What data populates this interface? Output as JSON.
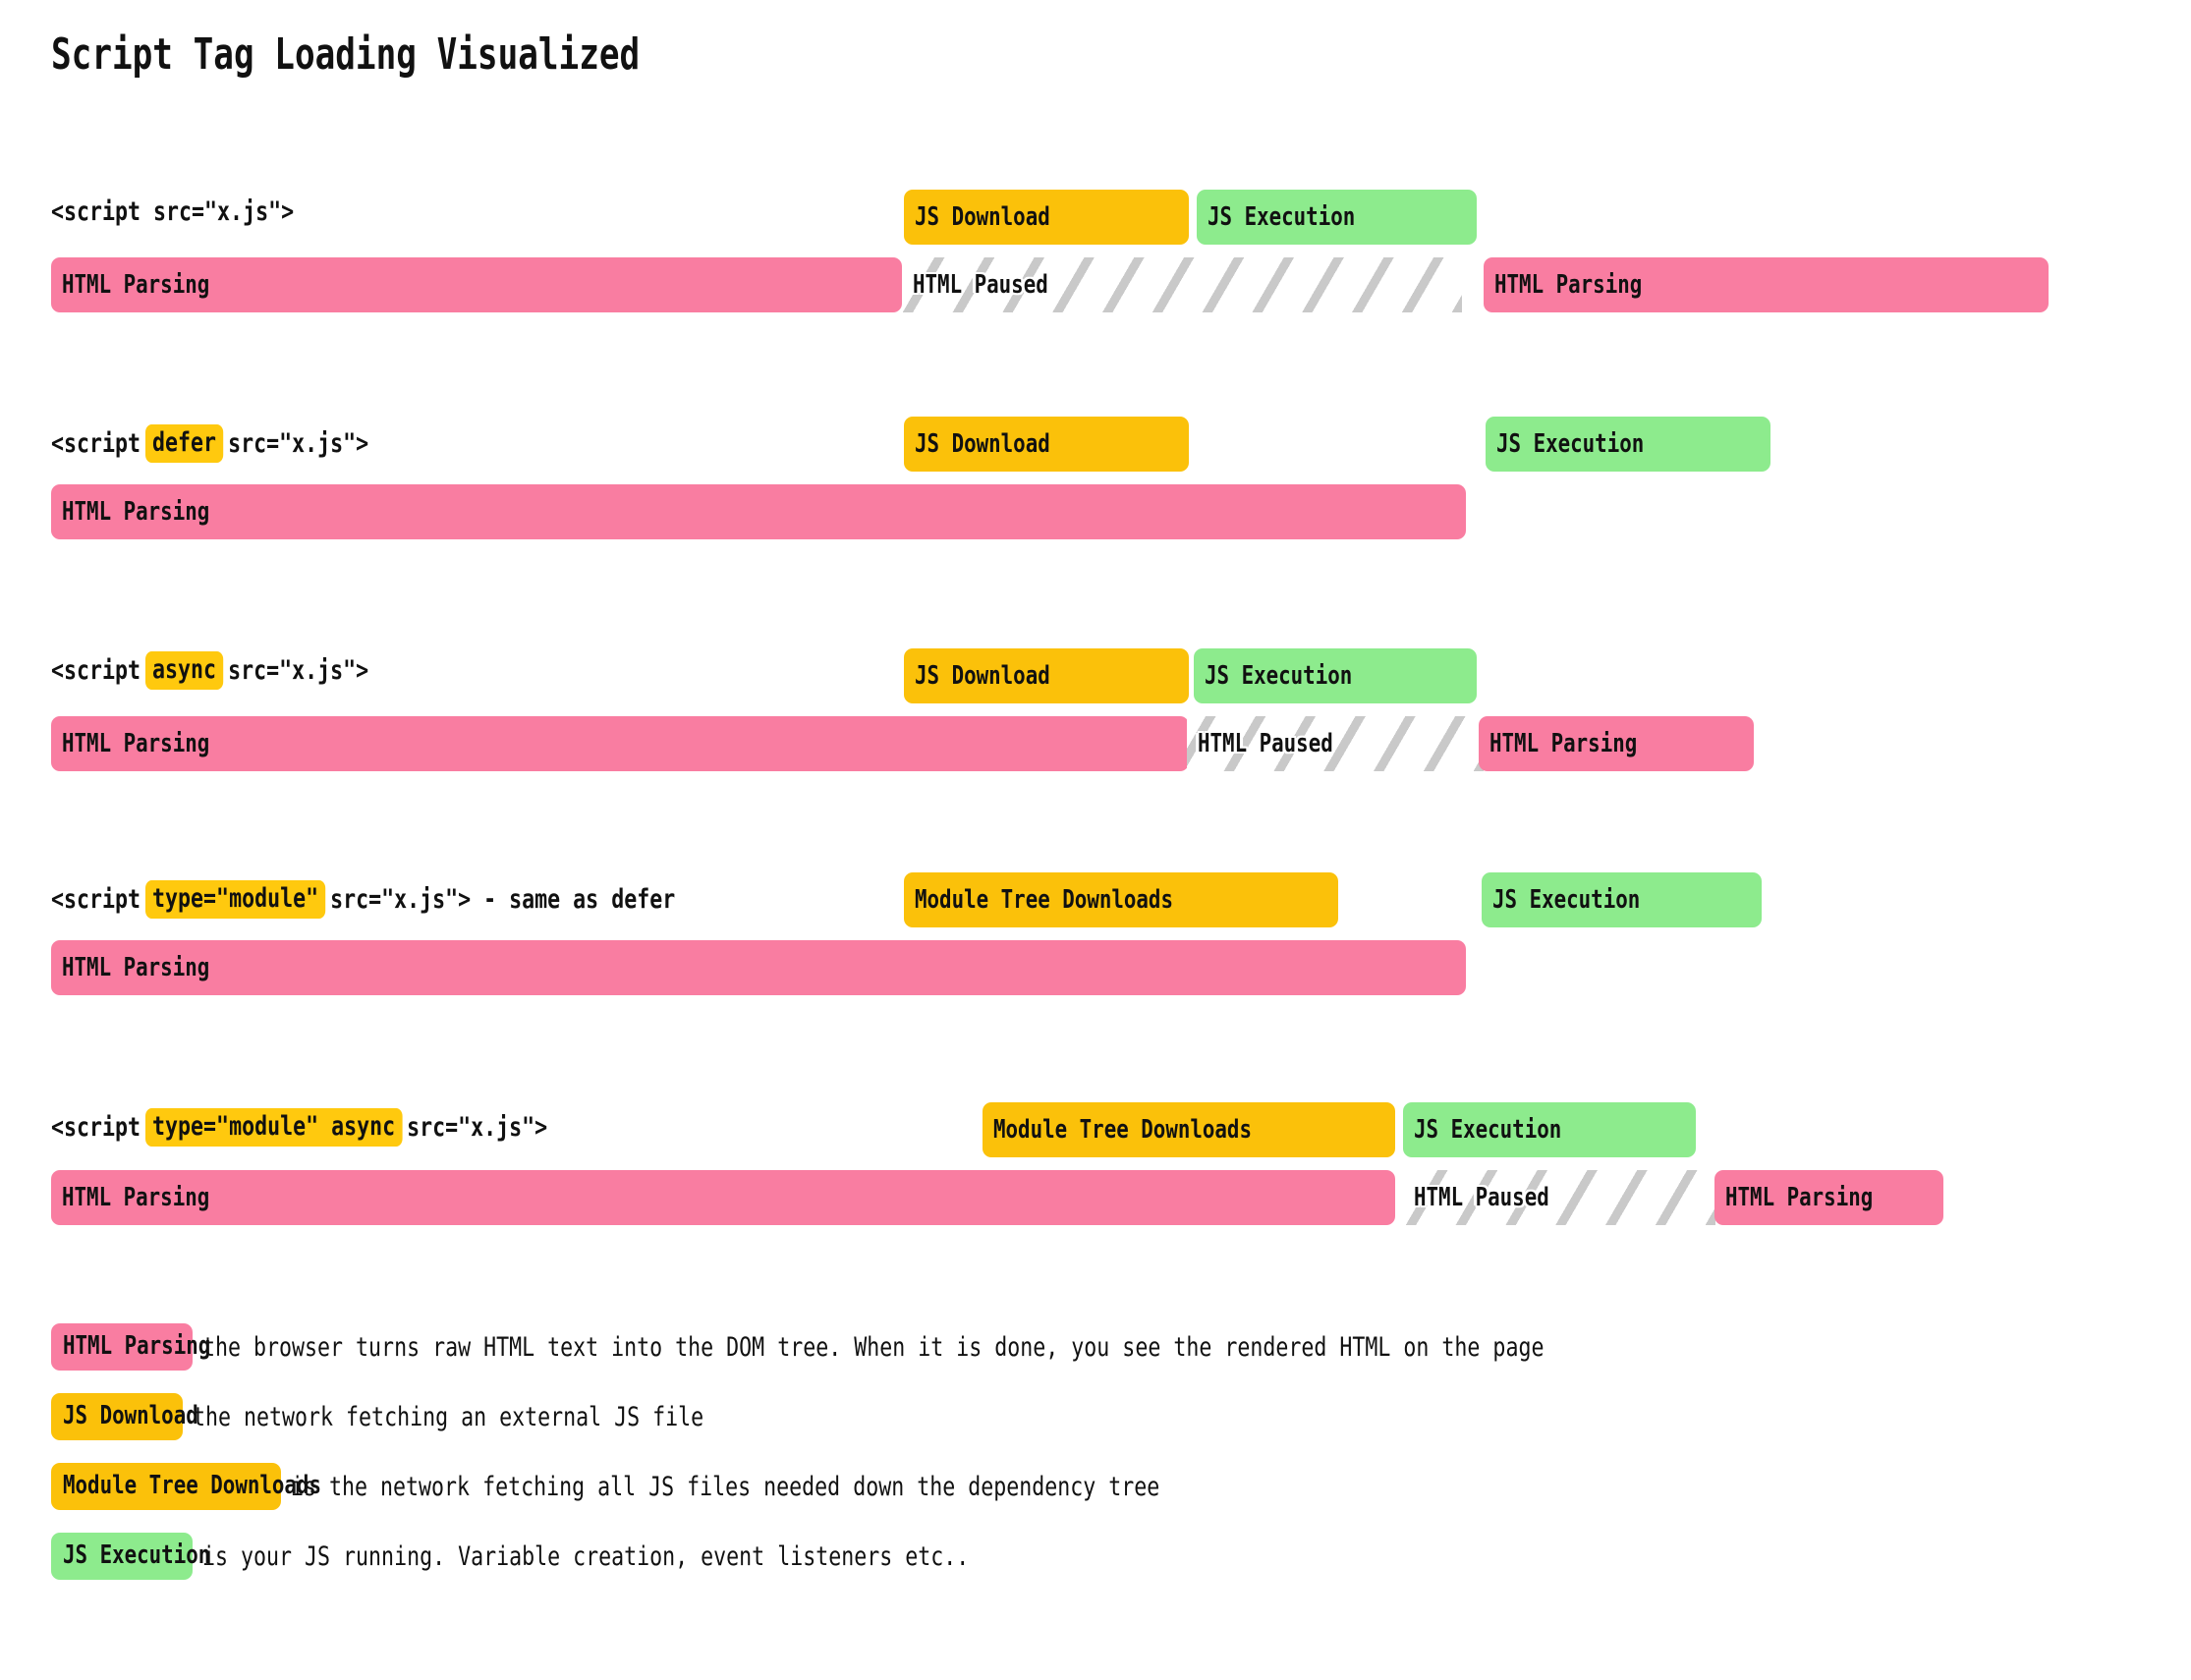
{
  "title": "Script Tag Loading Visualized",
  "colors": {
    "html_parsing": "#F97DA1",
    "js_download": "#FBC10A",
    "module_tree": "#FBC10A",
    "js_execution": "#8DEB8D",
    "html_paused_stripe": "#C9C9C9",
    "background": "#FFFFFF",
    "highlight": "#FFC90E"
  },
  "rows": [
    {
      "id": "plain-script",
      "label_parts": [
        {
          "text": "<script src=\"x.js\">",
          "highlight": false
        }
      ],
      "top_bars": [
        {
          "name": "js-download",
          "label": "JS Download",
          "kind": "yellow"
        },
        {
          "name": "js-execution",
          "label": "JS Execution",
          "kind": "green"
        }
      ],
      "bottom_bars": [
        {
          "name": "html-parsing",
          "label": "HTML Parsing",
          "kind": "pink"
        },
        {
          "name": "html-paused",
          "label": "HTML Paused",
          "kind": "paused"
        },
        {
          "name": "html-parsing",
          "label": "HTML Parsing",
          "kind": "pink"
        }
      ]
    },
    {
      "id": "defer-script",
      "label_parts": [
        {
          "text": "<script",
          "highlight": false
        },
        {
          "text": "defer",
          "highlight": true
        },
        {
          "text": "src=\"x.js\">",
          "highlight": false
        }
      ],
      "top_bars": [
        {
          "name": "js-download",
          "label": "JS Download",
          "kind": "yellow"
        },
        {
          "name": "js-execution",
          "label": "JS Execution",
          "kind": "green"
        }
      ],
      "bottom_bars": [
        {
          "name": "html-parsing",
          "label": "HTML Parsing",
          "kind": "pink"
        }
      ]
    },
    {
      "id": "async-script",
      "label_parts": [
        {
          "text": "<script",
          "highlight": false
        },
        {
          "text": "async",
          "highlight": true
        },
        {
          "text": "src=\"x.js\">",
          "highlight": false
        }
      ],
      "top_bars": [
        {
          "name": "js-download",
          "label": "JS Download",
          "kind": "yellow"
        },
        {
          "name": "js-execution",
          "label": "JS Execution",
          "kind": "green"
        }
      ],
      "bottom_bars": [
        {
          "name": "html-parsing",
          "label": "HTML Parsing",
          "kind": "pink"
        },
        {
          "name": "html-paused",
          "label": "HTML Paused",
          "kind": "paused"
        },
        {
          "name": "html-parsing",
          "label": "HTML Parsing",
          "kind": "pink"
        }
      ]
    },
    {
      "id": "module-script",
      "label_parts": [
        {
          "text": "<script",
          "highlight": false
        },
        {
          "text": "type=\"module\"",
          "highlight": true
        },
        {
          "text": "src=\"x.js\"> - same as defer",
          "highlight": false
        }
      ],
      "top_bars": [
        {
          "name": "module-tree-downloads",
          "label": "Module Tree Downloads",
          "kind": "yellow"
        },
        {
          "name": "js-execution",
          "label": "JS Execution",
          "kind": "green"
        }
      ],
      "bottom_bars": [
        {
          "name": "html-parsing",
          "label": "HTML Parsing",
          "kind": "pink"
        }
      ]
    },
    {
      "id": "module-async-script",
      "label_parts": [
        {
          "text": "<script",
          "highlight": false
        },
        {
          "text": "type=\"module\" async",
          "highlight": true
        },
        {
          "text": "src=\"x.js\">",
          "highlight": false
        }
      ],
      "top_bars": [
        {
          "name": "module-tree-downloads",
          "label": "Module Tree Downloads",
          "kind": "yellow"
        },
        {
          "name": "js-execution",
          "label": "JS Execution",
          "kind": "green"
        }
      ],
      "bottom_bars": [
        {
          "name": "html-parsing",
          "label": "HTML Parsing",
          "kind": "pink"
        },
        {
          "name": "html-paused",
          "label": "HTML Paused",
          "kind": "paused"
        },
        {
          "name": "html-parsing",
          "label": "HTML Parsing",
          "kind": "pink"
        }
      ]
    }
  ],
  "legend": [
    {
      "id": "html-parsing",
      "chip": "HTML Parsing",
      "kind": "pink",
      "description": "the browser turns raw HTML text into the DOM tree. When it is done, you see the rendered HTML on the page"
    },
    {
      "id": "js-download",
      "chip": "JS Download",
      "kind": "yellow",
      "description": "the network fetching an external JS file"
    },
    {
      "id": "module-tree-downloads",
      "chip": "Module Tree Downloads",
      "kind": "yellow",
      "description": "is the network fetching all JS files needed down the dependency tree"
    },
    {
      "id": "js-execution",
      "chip": "JS Execution",
      "kind": "green",
      "description": "is your JS running. Variable creation, event listeners etc.."
    }
  ]
}
